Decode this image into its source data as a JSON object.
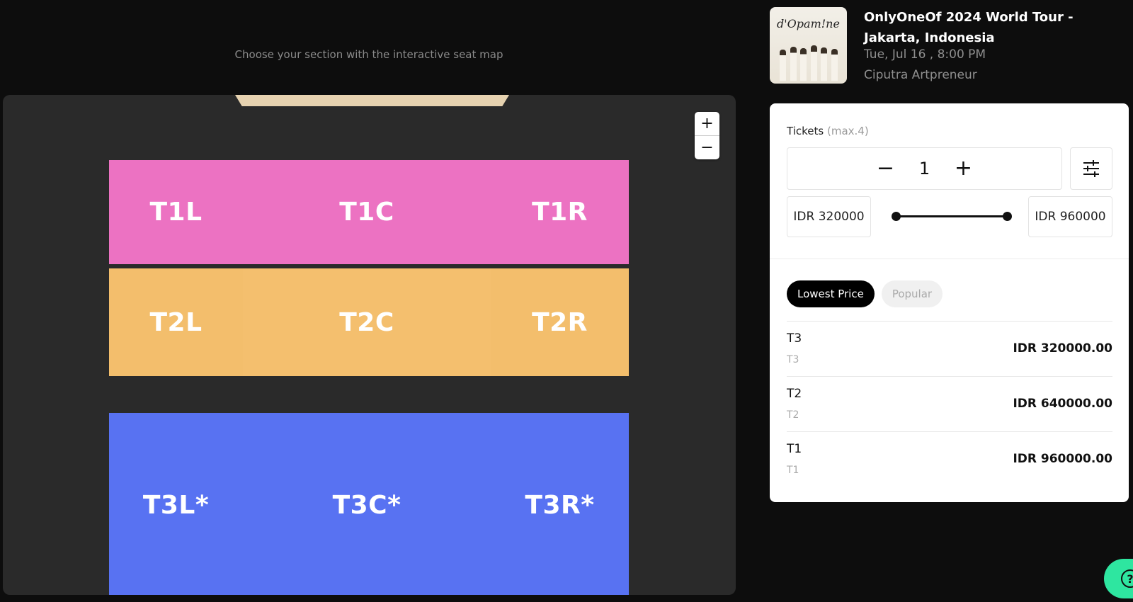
{
  "instructions": "Choose your section with the interactive seat map",
  "map": {
    "zoom_in": "+",
    "zoom_out": "−",
    "tiers": [
      {
        "sections": [
          "T1L",
          "T1C",
          "T1R"
        ],
        "color": "#ec72c2"
      },
      {
        "sections": [
          "T2L",
          "T2C",
          "T2R"
        ],
        "color": "#f3be6c"
      },
      {
        "sections": [
          "T3L*",
          "T3C*",
          "T3R*"
        ],
        "color": "#5872f2"
      }
    ],
    "stage_color": "#e6d2b0"
  },
  "event": {
    "poster_title": "d'Opam!ne",
    "title": "OnlyOneOf 2024 World Tour - Jakarta, Indonesia",
    "date": "Tue, Jul 16 , 8:00 PM",
    "venue": "Ciputra Artpreneur"
  },
  "tickets": {
    "label": "Tickets",
    "max_note": "(max.4)",
    "minus": "−",
    "plus": "+",
    "quantity": "1",
    "filter_icon": "sliders-icon",
    "price_min": "IDR 320000",
    "price_max": "IDR 960000",
    "price_range_selected": [
      0,
      1
    ]
  },
  "sort": {
    "lowest": "Lowest Price",
    "popular": "Popular"
  },
  "listings": [
    {
      "name": "T3",
      "sub": "T3",
      "price": "IDR 320000.00"
    },
    {
      "name": "T2",
      "sub": "T2",
      "price": "IDR 640000.00"
    },
    {
      "name": "T1",
      "sub": "T1",
      "price": "IDR 960000.00"
    }
  ],
  "help": {
    "icon": "help-icon",
    "label": "?",
    "color": "#2ee6a0"
  }
}
